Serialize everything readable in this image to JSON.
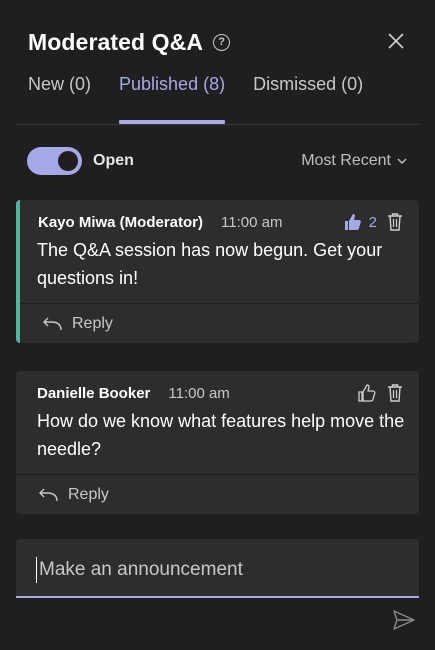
{
  "header": {
    "title": "Moderated Q&A",
    "help_glyph": "?"
  },
  "tabs": [
    {
      "label": "New (0)",
      "active": false
    },
    {
      "label": "Published (8)",
      "active": true
    },
    {
      "label": "Dismissed (0)",
      "active": false
    }
  ],
  "toolbar": {
    "toggle_label": "Open",
    "toggle_on": true,
    "sort_label": "Most Recent"
  },
  "posts": [
    {
      "author": "Kayo Miwa (Moderator)",
      "time": "11:00 am",
      "message": "The Q&A session has now begun. Get your questions in!",
      "likes": "2",
      "liked": true,
      "reply_label": "Reply"
    },
    {
      "author": "Danielle Booker",
      "time": "11:00 am",
      "message": "How do we know what features help move the needle?",
      "likes": "",
      "liked": false,
      "reply_label": "Reply"
    }
  ],
  "compose": {
    "placeholder": "Make an announcement",
    "value": ""
  },
  "colors": {
    "background": "#1f1f1f",
    "card": "#2d2d2d",
    "accent": "#a7a8e6",
    "pinned": "#4fb79b"
  },
  "icons": [
    "help-icon",
    "close-icon",
    "chevron-down-icon",
    "thumbs-up-icon",
    "trash-icon",
    "reply-icon",
    "send-icon"
  ]
}
